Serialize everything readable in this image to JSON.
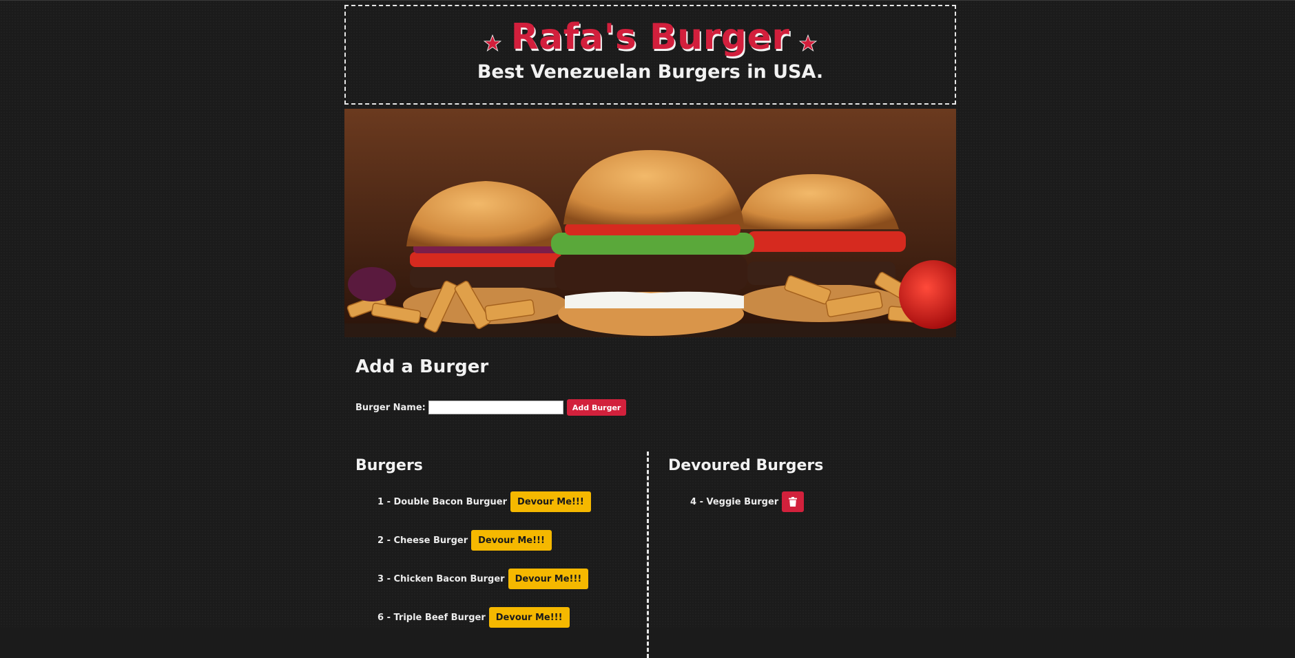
{
  "header": {
    "title": "Rafa's Burger",
    "tagline": "Best Venezuelan Burgers in USA.",
    "star_icon": "star-icon",
    "accent_color": "#d21f3c"
  },
  "hero": {
    "description_icon": "burgers-hero-image"
  },
  "add_form": {
    "heading": "Add a Burger",
    "label": "Burger Name:",
    "input_value": "",
    "button_label": "Add Burger"
  },
  "burgers": {
    "heading": "Burgers",
    "items": [
      {
        "text": "1 - Double Bacon Burguer",
        "button": "Devour Me!!!"
      },
      {
        "text": "2 - Cheese Burger",
        "button": "Devour Me!!!"
      },
      {
        "text": "3 - Chicken Bacon Burger",
        "button": "Devour Me!!!"
      },
      {
        "text": "6 - Triple Beef Burger",
        "button": "Devour Me!!!"
      }
    ]
  },
  "devoured": {
    "heading": "Devoured Burgers",
    "items": [
      {
        "text": "4 - Veggie Burger",
        "icon": "trash-icon"
      }
    ]
  }
}
